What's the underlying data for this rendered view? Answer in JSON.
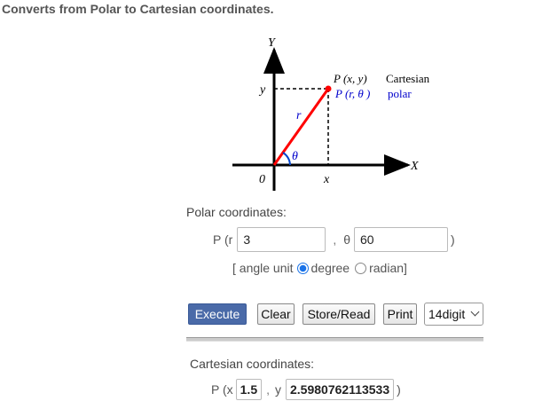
{
  "title": "Converts from Polar to Cartesian coordinates.",
  "diagram": {
    "axis_y": "Y",
    "axis_x": "X",
    "label_y": "y",
    "label_x": "x",
    "label_origin": "0",
    "label_r": "r",
    "label_theta": "θ",
    "point_cartesian_prefix": "P (x, y)",
    "point_cartesian_word": "Cartesian",
    "point_polar_prefix": "P (r, θ )",
    "point_polar_word": "polar",
    "colors": {
      "radius_line": "#ff0000",
      "polar_text": "#0000cc",
      "angle_arc": "#0044cc"
    }
  },
  "polar": {
    "section_label": "Polar coordinates:",
    "p_label": "P (r",
    "r_value": "3",
    "comma": ",",
    "theta_label": "θ",
    "theta_value": "60",
    "close_paren": ")",
    "angle_unit_label": "[ angle unit",
    "option_degree": "degree",
    "option_radian": "radian]",
    "selected_unit": "degree"
  },
  "buttons": {
    "execute": "Execute",
    "clear": "Clear",
    "store_read": "Store/Read",
    "print": "Print",
    "digits": "14digit"
  },
  "cartesian": {
    "section_label": "Cartesian coordinates:",
    "p_label": "P (x",
    "x_value": "1.5",
    "comma": ",",
    "y_label": "y",
    "y_value": "2.5980762113533",
    "close_paren": ")"
  },
  "colors": {
    "execute_bg": "#4a6aa8",
    "radio_selected": "#1a73e8"
  }
}
